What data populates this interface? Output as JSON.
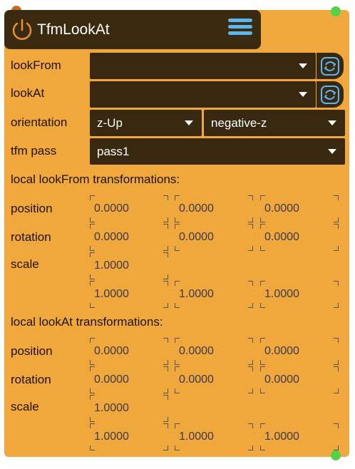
{
  "node": {
    "title": "TfmLookAt",
    "colors": {
      "body": "#f0a73b",
      "header": "#3a2a10",
      "field": "#38280f",
      "accent": "#5cb6f0"
    }
  },
  "rows": {
    "lookFrom": {
      "label": "lookFrom",
      "value": ""
    },
    "lookAt": {
      "label": "lookAt",
      "value": ""
    },
    "orientation": {
      "label": "orientation",
      "up": "z-Up",
      "axis": "negative-z"
    },
    "tfm_pass": {
      "label": "tfm pass",
      "value": "pass1"
    }
  },
  "icons": {
    "power": "power-icon",
    "menu": "hamburger-menu-icon",
    "refresh": "refresh-icon",
    "dropdown": "chevron-down-icon"
  },
  "lookFrom_tfm": {
    "title": "local lookFrom transformations:",
    "position_label": "position",
    "rotation_label": "rotation",
    "scale_label": "scale",
    "position": [
      "0.0000",
      "0.0000",
      "0.0000"
    ],
    "rotation": [
      "0.0000",
      "0.0000",
      "0.0000"
    ],
    "scale_uniform": "1.0000",
    "scale": [
      "1.0000",
      "1.0000",
      "1.0000"
    ]
  },
  "lookAt_tfm": {
    "title": "local lookAt transformations:",
    "position_label": "position",
    "rotation_label": "rotation",
    "scale_label": "scale",
    "position": [
      "0.0000",
      "0.0000",
      "0.0000"
    ],
    "rotation": [
      "0.0000",
      "0.0000",
      "0.0000"
    ],
    "scale_uniform": "1.0000",
    "scale": [
      "1.0000",
      "1.0000",
      "1.0000"
    ]
  }
}
